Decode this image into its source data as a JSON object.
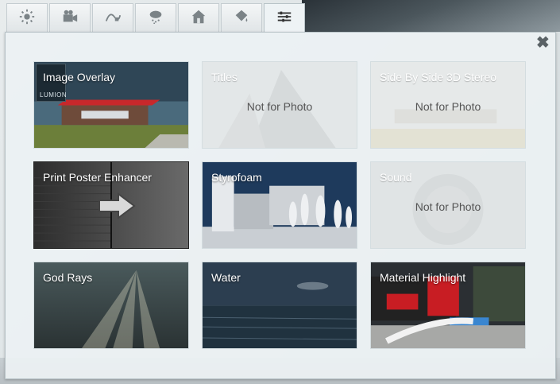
{
  "tabs": [
    {
      "icon": "sun-icon"
    },
    {
      "icon": "camera-icon"
    },
    {
      "icon": "curve-icon"
    },
    {
      "icon": "weather-icon"
    },
    {
      "icon": "house-icon"
    },
    {
      "icon": "paint-bucket-icon"
    },
    {
      "icon": "sliders-icon"
    }
  ],
  "close_label": "✖",
  "tiles": [
    {
      "title": "Image Overlay",
      "note": "",
      "logo": "LUMION"
    },
    {
      "title": "Titles",
      "note": "Not for Photo"
    },
    {
      "title": "Side By Side 3D Stereo",
      "note": "Not for Photo"
    },
    {
      "title": "Print Poster Enhancer",
      "note": ""
    },
    {
      "title": "Styrofoam",
      "note": ""
    },
    {
      "title": "Sound",
      "note": "Not for Photo"
    },
    {
      "title": "God Rays",
      "note": ""
    },
    {
      "title": "Water",
      "note": ""
    },
    {
      "title": "Material Highlight",
      "note": ""
    }
  ]
}
